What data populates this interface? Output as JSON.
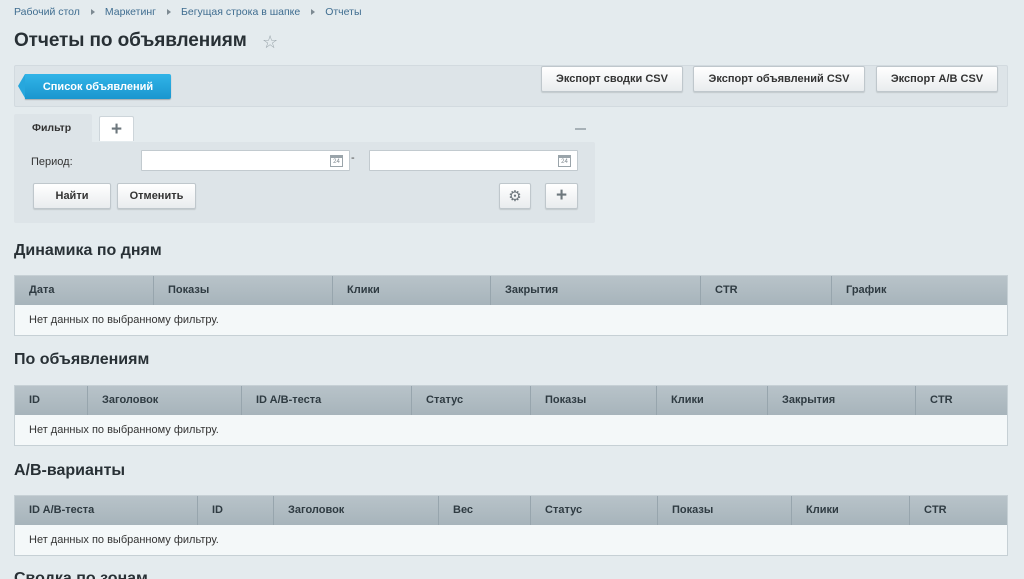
{
  "breadcrumb": [
    "Рабочий стол",
    "Маркетинг",
    "Бегущая строка в шапке",
    "Отчеты"
  ],
  "page_title": "Отчеты по объявлениям",
  "toolbar": {
    "list_button": "Список объявлений",
    "export_summary": "Экспорт сводки CSV",
    "export_ads": "Экспорт объявлений CSV",
    "export_ab": "Экспорт A/B CSV"
  },
  "filter": {
    "tab_label": "Фильтр",
    "add_tab": "+",
    "period_label": "Период:",
    "date_from": "",
    "date_to": "",
    "date_separator": "-",
    "calendar_day": "24",
    "find_button": "Найти",
    "cancel_button": "Отменить"
  },
  "sections": {
    "daily": {
      "title": "Динамика по дням",
      "columns": [
        "Дата",
        "Показы",
        "Клики",
        "Закрытия",
        "CTR",
        "График"
      ],
      "empty": "Нет данных по выбранному фильтру."
    },
    "ads": {
      "title": "По объявлениям",
      "columns": [
        "ID",
        "Заголовок",
        "ID A/B-теста",
        "Статус",
        "Показы",
        "Клики",
        "Закрытия",
        "CTR"
      ],
      "empty": "Нет данных по выбранному фильтру."
    },
    "ab": {
      "title": "A/B-варианты",
      "columns": [
        "ID A/B-теста",
        "ID",
        "Заголовок",
        "Вес",
        "Статус",
        "Показы",
        "Клики",
        "CTR"
      ],
      "empty": "Нет данных по выбранному фильтру."
    },
    "zones": {
      "title": "Сводка по зонам"
    }
  },
  "icons": {
    "favorite": "star-icon",
    "calendar": "calendar-icon",
    "settings": "gear-icon",
    "add": "plus-icon"
  },
  "colors": {
    "primary_button": "#1f9fd8",
    "background": "#e4ebee",
    "grid_header": "#aeb9bf"
  }
}
